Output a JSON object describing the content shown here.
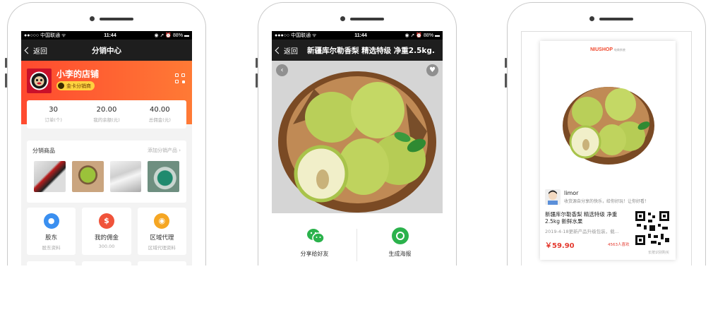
{
  "phone1": {
    "status": {
      "carrier": "●●○○○ 中国联通 ᯤ",
      "time": "11:44",
      "battery": "◉ ➚ ⏰ 88% ▬"
    },
    "nav": {
      "back_label": "返回",
      "title": "分销中心"
    },
    "shop": {
      "name": "小李的店铺",
      "tier_badge": "金卡分销商"
    },
    "stats": [
      {
        "value": "30",
        "label": "订单(个)"
      },
      {
        "value": "20.00",
        "label": "我的余额(元)"
      },
      {
        "value": "40.00",
        "label": "总佣金(元)"
      }
    ],
    "goods": {
      "title": "分销商品",
      "more_link": "添加分销产品 ›"
    },
    "tiles": [
      {
        "icon": "person",
        "title": "股东",
        "sub": "股东资料",
        "color": "#3a8ff0"
      },
      {
        "icon": "money-bag",
        "title": "我的佣金",
        "sub": "300.00",
        "color": "#f0533a"
      },
      {
        "icon": "location",
        "title": "区域代理",
        "sub": "区域代理资料",
        "color": "#f5a623"
      }
    ]
  },
  "phone2": {
    "status": {
      "carrier": "●●●○○ 中国联通 ᯤ",
      "time": "11:44",
      "battery": "◉ ➚ ⏰ 88% ▬"
    },
    "nav": {
      "back_label": "返回",
      "title": "新疆库尔勒香梨 精选特级 净重2.5kg..."
    },
    "share": [
      {
        "icon": "wechat",
        "label": "分享给好友",
        "color": "#2bb24c"
      },
      {
        "icon": "poster",
        "label": "生成海报",
        "color": "#2bb24c"
      }
    ]
  },
  "phone3": {
    "brand": "NIUSHOP",
    "brand_sub": "电商系统",
    "user": {
      "name": "limor",
      "quote": "收货源自分享的快乐，给你好玩！让你好看！"
    },
    "product": {
      "title": "新疆库尔勒香梨 精选特级 净重2.5kg 新鲜水果",
      "desc": "2019-4-18更新产品升级包装，载...",
      "price": "￥59.90",
      "likes": "4563人喜欢"
    },
    "qr_caption": "长按识别购买"
  },
  "colors": {
    "accent": "#ff5a30",
    "green": "#2bb24c",
    "price": "#e43a2f"
  }
}
